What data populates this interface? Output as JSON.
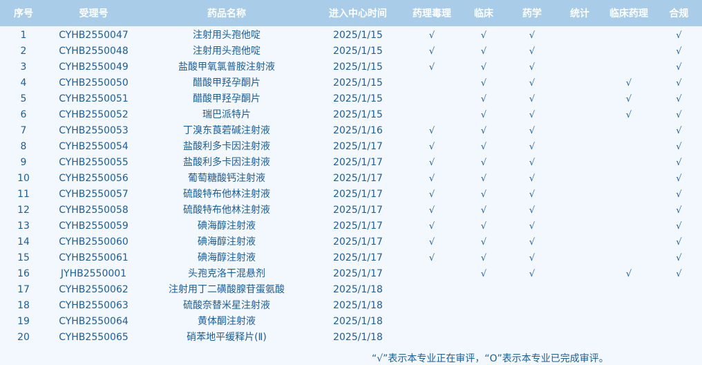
{
  "headers": [
    "序号",
    "受理号",
    "药品名称",
    "进入中心时间",
    "药理毒理",
    "临床",
    "药学",
    "统计",
    "临床药理",
    "合规"
  ],
  "rows": [
    [
      "1",
      "CYHB2550047",
      "注射用头孢他啶",
      "2025/1/15",
      "√",
      "√",
      "√",
      "",
      "",
      "√"
    ],
    [
      "2",
      "CYHB2550048",
      "注射用头孢他啶",
      "2025/1/15",
      "√",
      "√",
      "√",
      "",
      "",
      "√"
    ],
    [
      "3",
      "CYHB2550049",
      "盐酸甲氧氯普胺注射液",
      "2025/1/15",
      "√",
      "√",
      "√",
      "",
      "",
      "√"
    ],
    [
      "4",
      "CYHB2550050",
      "醋酸甲羟孕酮片",
      "2025/1/15",
      "",
      "√",
      "√",
      "",
      "√",
      "√"
    ],
    [
      "5",
      "CYHB2550051",
      "醋酸甲羟孕酮片",
      "2025/1/15",
      "",
      "√",
      "√",
      "",
      "√",
      "√"
    ],
    [
      "6",
      "CYHB2550052",
      "瑞巴派特片",
      "2025/1/15",
      "",
      "√",
      "√",
      "",
      "√",
      "√"
    ],
    [
      "7",
      "CYHB2550053",
      "丁溴东莨菪碱注射液",
      "2025/1/16",
      "√",
      "√",
      "√",
      "",
      "",
      "√"
    ],
    [
      "8",
      "CYHB2550054",
      "盐酸利多卡因注射液",
      "2025/1/17",
      "√",
      "√",
      "√",
      "",
      "",
      "√"
    ],
    [
      "9",
      "CYHB2550055",
      "盐酸利多卡因注射液",
      "2025/1/17",
      "√",
      "√",
      "√",
      "",
      "",
      "√"
    ],
    [
      "10",
      "CYHB2550056",
      "葡萄糖酸钙注射液",
      "2025/1/17",
      "√",
      "√",
      "√",
      "",
      "",
      "√"
    ],
    [
      "11",
      "CYHB2550057",
      "硫酸特布他林注射液",
      "2025/1/17",
      "√",
      "√",
      "√",
      "",
      "",
      "√"
    ],
    [
      "12",
      "CYHB2550058",
      "硫酸特布他林注射液",
      "2025/1/17",
      "√",
      "√",
      "√",
      "",
      "",
      "√"
    ],
    [
      "13",
      "CYHB2550059",
      "碘海醇注射液",
      "2025/1/17",
      "√",
      "√",
      "√",
      "",
      "",
      "√"
    ],
    [
      "14",
      "CYHB2550060",
      "碘海醇注射液",
      "2025/1/17",
      "√",
      "√",
      "√",
      "",
      "",
      "√"
    ],
    [
      "15",
      "CYHB2550061",
      "碘海醇注射液",
      "2025/1/17",
      "√",
      "√",
      "√",
      "",
      "",
      "√"
    ],
    [
      "16",
      "JYHB2550001",
      "头孢克洛干混悬剂",
      "2025/1/17",
      "",
      "√",
      "√",
      "",
      "√",
      "√"
    ],
    [
      "17",
      "CYHB2550062",
      "注射用丁二磺酸腺苷蛋氨酸",
      "2025/1/18",
      "",
      "",
      "",
      "",
      "",
      ""
    ],
    [
      "18",
      "CYHB2550063",
      "硫酸奈替米星注射液",
      "2025/1/18",
      "",
      "",
      "",
      "",
      "",
      ""
    ],
    [
      "19",
      "CYHB2550064",
      "黄体酮注射液",
      "2025/1/18",
      "",
      "",
      "",
      "",
      "",
      ""
    ],
    [
      "20",
      "CYHB2550065",
      "硝苯地平缓释片(Ⅱ)",
      "2025/1/18",
      "",
      "",
      "",
      "",
      "",
      ""
    ]
  ],
  "note": "“√”表示本专业正在审评，“O”表示本专业已完成审评。",
  "colors": {
    "header_bg": "#a9cde9",
    "body_bg": "#f2f8fd",
    "text": "#1d5d98"
  }
}
